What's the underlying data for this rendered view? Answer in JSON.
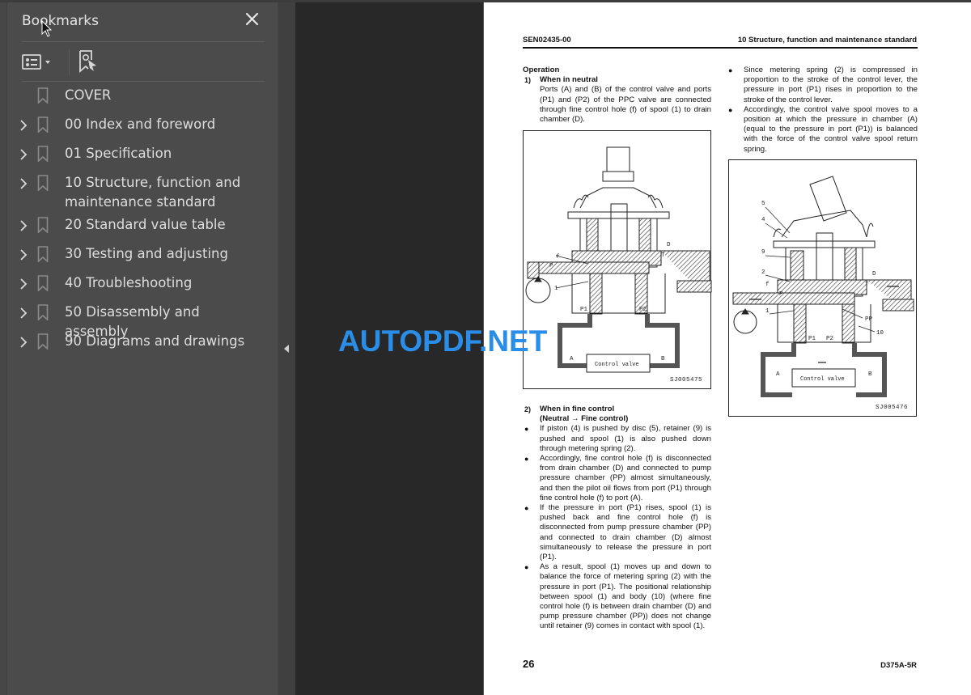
{
  "bookmarks_panel": {
    "title": "Bookmarks",
    "close_icon": "close-icon",
    "toolbar": {
      "options_icon": "list-options-icon",
      "find_bookmark_icon": "find-current-bookmark-icon"
    },
    "items": [
      {
        "label": "COVER",
        "expandable": false
      },
      {
        "label": "00 Index and foreword",
        "expandable": true
      },
      {
        "label": "01 Specification",
        "expandable": true
      },
      {
        "label": "10 Structure, function and maintenance standard",
        "expandable": true
      },
      {
        "label": "20 Standard value table",
        "expandable": true
      },
      {
        "label": "30 Testing and adjusting",
        "expandable": true
      },
      {
        "label": "40 Troubleshooting",
        "expandable": true
      },
      {
        "label": "50 Disassembly and assembly",
        "expandable": true
      },
      {
        "label": "90 Diagrams and drawings",
        "expandable": true
      }
    ]
  },
  "watermark": "AUTOPDF.NET",
  "watermark_color": "#2a8ee8",
  "document_page": {
    "header_left": "SEN02435-00",
    "header_right": "10 Structure, function and maintenance standard",
    "section_title": "Operation",
    "step1": {
      "number": "1)",
      "title": "When in neutral",
      "body": "Ports (A) and (B) of the control valve and ports (P1) and (P2) of the PPC valve are connected through fine control hole (f) of spool (1) to drain chamber (D)."
    },
    "figure1": {
      "id": "SJ005475",
      "labels": {
        "f": "f",
        "P": "P",
        "one": "1",
        "D": "D",
        "T": "T",
        "P1": "P1",
        "P2": "P2",
        "A": "A",
        "B": "B",
        "valve": "Control valve"
      }
    },
    "step2": {
      "number": "2)",
      "title": "When in fine control",
      "subtitle": "(Neutral → Fine control)",
      "bullets": [
        "If piston (4) is pushed by disc (5), retainer (9) is pushed and spool (1) is also pushed down through metering spring (2).",
        "Accordingly, fine control hole (f) is disconnected from drain chamber (D) and connected to pump pressure chamber (PP) almost simultaneously, and then the pilot oil flows from port (P1) through fine control hole (f) to port (A).",
        "If the pressure in port (P1) rises, spool (1) is pushed back and fine control hole (f) is disconnected from pump pressure chamber (PP) and connected to drain chamber (D) almost simultaneously to release the pressure in port (P1).",
        "As a result, spool (1) moves up and down to balance the force of metering spring (2) with the pressure in port (P1).  The positional relationship between spool (1) and body (10) (where fine control hole (f) is between drain chamber (D) and pump pressure chamber (PP)) does not change until retainer (9) comes in contact with spool (1)."
      ]
    },
    "right_bullets": [
      "Since metering spring (2) is compressed in proportion to the stroke of the control lever, the pressure in port (P1) rises in proportion to the stroke of the control lever.",
      "Accordingly, the control valve spool moves to a position at which the pressure in chamber (A) (equal to the pressure in port (P1)) is balanced with the force of the control valve spool return spring."
    ],
    "figure2": {
      "id": "SJ005476",
      "labels": {
        "five": "5",
        "four": "4",
        "nine": "9",
        "two": "2",
        "f": "f",
        "P": "P",
        "one": "1",
        "D": "D",
        "T": "T",
        "PP": "PP",
        "ten": "10",
        "P1": "P1",
        "P2": "P2",
        "A": "A",
        "B": "B",
        "valve": "Control valve"
      }
    },
    "page_number": "26",
    "model": "D375A-5R"
  }
}
